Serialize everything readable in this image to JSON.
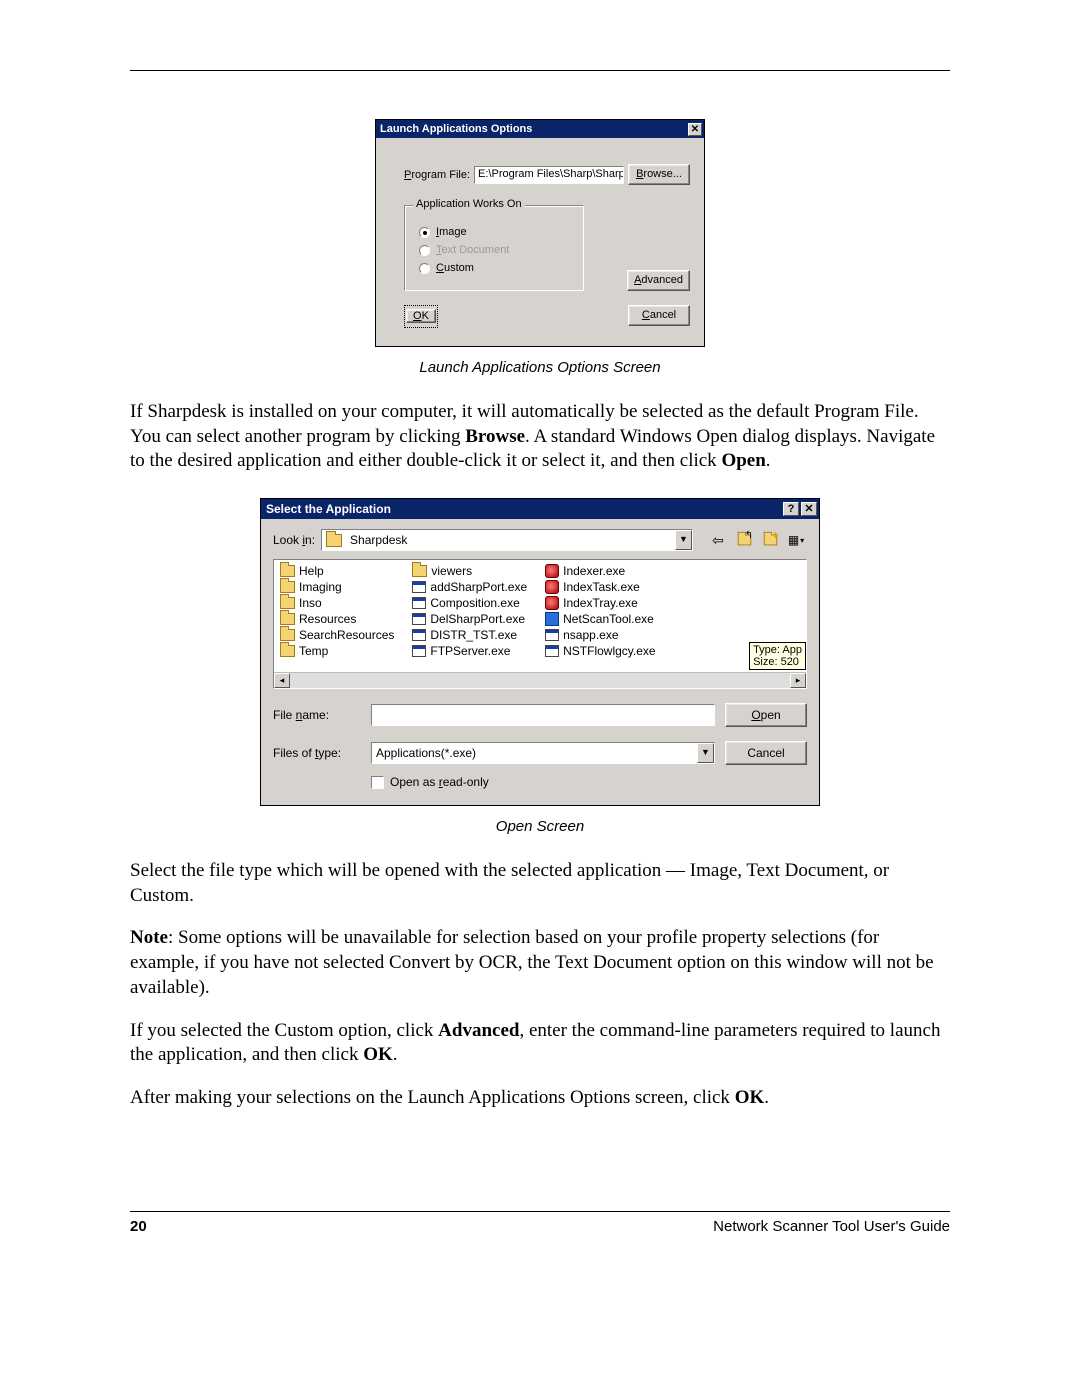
{
  "dialog1": {
    "title": "Launch Applications Options",
    "program_file_label_pre": "P",
    "program_file_label_post": "rogram File:",
    "program_file_value": "E:\\Program Files\\Sharp\\Sharpdes",
    "browse_pre": "B",
    "browse_post": "rowse...",
    "groupbox": "Application Works On",
    "radio_image_pre": "I",
    "radio_image_post": "mage",
    "radio_text_pre": "T",
    "radio_text_post": "ext Document",
    "radio_custom_pre": "C",
    "radio_custom_post": "ustom",
    "advanced_pre": "A",
    "advanced_post": "dvanced",
    "ok_pre": "O",
    "ok_post": "K",
    "cancel_pre": "C",
    "cancel_post": "ancel"
  },
  "caption1": "Launch Applications Options Screen",
  "para1_a": "If Sharpdesk is installed on your computer, it will automatically be selected as the default Program File. You can select another program by clicking ",
  "para1_b": "Browse",
  "para1_c": ". A standard Windows Open dialog displays. Navigate to the desired application and either double-click it or select it, and then click ",
  "para1_d": "Open",
  "para1_e": ".",
  "dialog2": {
    "title": "Select the Application",
    "lookin_label_pre": "Look ",
    "lookin_label_u": "i",
    "lookin_label_post": "n:",
    "lookin_value": "Sharpdesk",
    "col1": [
      "Help",
      "Imaging",
      "Inso",
      "Resources",
      "SearchResources",
      "Temp"
    ],
    "col2": [
      {
        "icon": "folder",
        "name": "viewers"
      },
      {
        "icon": "win",
        "name": "addSharpPort.exe"
      },
      {
        "icon": "win",
        "name": "Composition.exe"
      },
      {
        "icon": "win",
        "name": "DelSharpPort.exe"
      },
      {
        "icon": "win",
        "name": "DISTR_TST.exe"
      },
      {
        "icon": "win",
        "name": "FTPServer.exe"
      }
    ],
    "col3": [
      {
        "icon": "red",
        "name": "Indexer.exe"
      },
      {
        "icon": "red",
        "name": "IndexTask.exe"
      },
      {
        "icon": "red",
        "name": "IndexTray.exe"
      },
      {
        "icon": "blue",
        "name": "NetScanTool.exe"
      },
      {
        "icon": "win",
        "name": "nsapp.exe"
      },
      {
        "icon": "win",
        "name": "NSTFlowlgcy.exe"
      }
    ],
    "tooltip_l1": "Type: App",
    "tooltip_l2": "Size: 520",
    "filename_label_pre": "File ",
    "filename_label_u": "n",
    "filename_label_post": "ame:",
    "filetype_label_pre": "Files of ",
    "filetype_label_u": "t",
    "filetype_label_post": "ype:",
    "filetype_value": "Applications(*.exe)",
    "open_u": "O",
    "open_post": "pen",
    "cancel": "Cancel",
    "readonly_pre": "Open as ",
    "readonly_u": "r",
    "readonly_post": "ead-only"
  },
  "caption2": "Open Screen",
  "para2": "Select the file type which will be opened with the selected application — Image, Text Document, or Custom.",
  "para3_a": "Note",
  "para3_b": ": Some options will be unavailable for selection based on your profile property selections (for example, if you have not selected Convert by OCR, the Text Document option on this window will not be available).",
  "para4_a": "If you selected the Custom option, click ",
  "para4_b": "Advanced",
  "para4_c": ", enter the command-line parameters required to launch the application, and then click ",
  "para4_d": "OK",
  "para4_e": ".",
  "para5_a": "After making your selections on the Launch Applications Options screen, click ",
  "para5_b": "OK",
  "para5_c": ".",
  "footer": {
    "page": "20",
    "guide": "Network Scanner Tool User's Guide"
  }
}
